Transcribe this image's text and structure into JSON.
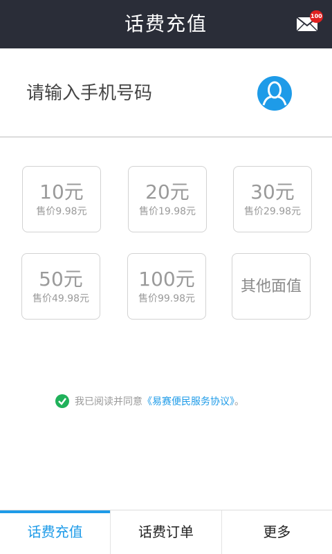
{
  "header": {
    "title": "话费充值",
    "mail_badge": "100"
  },
  "phone": {
    "placeholder": "请输入手机号码"
  },
  "denominations": [
    {
      "amount": "10元",
      "price": "售价9.98元"
    },
    {
      "amount": "20元",
      "price": "售价19.98元"
    },
    {
      "amount": "30元",
      "price": "售价29.98元"
    },
    {
      "amount": "50元",
      "price": "售价49.98元"
    },
    {
      "amount": "100元",
      "price": "售价99.98元"
    },
    {
      "amount": "其他面值"
    }
  ],
  "agreement": {
    "text": "我已阅读并同意",
    "link": "《易赛便民服务协议》",
    "suffix": "。"
  },
  "tabs": [
    {
      "label": "话费充值",
      "active": true
    },
    {
      "label": "话费订单",
      "active": false
    },
    {
      "label": "更多",
      "active": false
    }
  ],
  "colors": {
    "header_bg": "#2a2d38",
    "accent": "#1e9be8",
    "check": "#20b15a",
    "badge": "#e02020"
  }
}
